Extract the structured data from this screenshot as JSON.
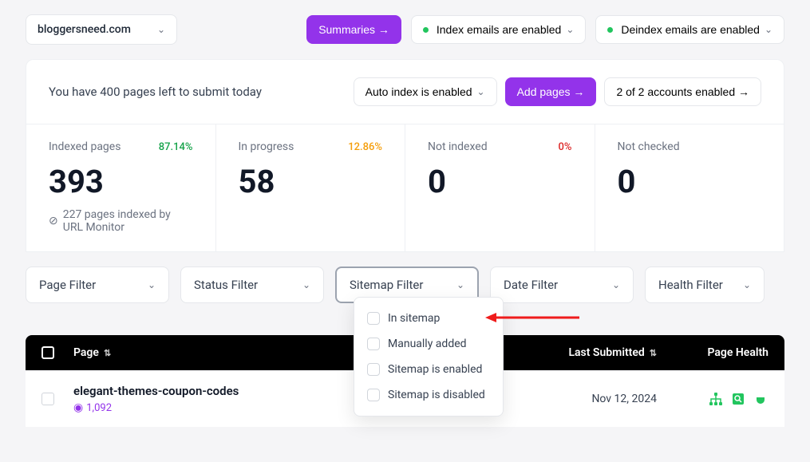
{
  "header": {
    "domain": "bloggersneed.com",
    "summaries": "Summaries →",
    "index_emails": "Index emails are enabled",
    "deindex_emails": "Deindex emails are enabled"
  },
  "submit": {
    "text": "You have 400 pages left to submit today",
    "auto_index": "Auto index is enabled",
    "add_pages": "Add pages →",
    "accounts": "2 of 2 accounts enabled →"
  },
  "stats": {
    "indexed": {
      "label": "Indexed pages",
      "pct": "87.14%",
      "value": "393",
      "sub": "227 pages indexed by URL Monitor"
    },
    "progress": {
      "label": "In progress",
      "pct": "12.86%",
      "value": "58"
    },
    "not_indexed": {
      "label": "Not indexed",
      "pct": "0%",
      "value": "0"
    },
    "not_checked": {
      "label": "Not checked",
      "value": "0"
    }
  },
  "filters": {
    "page": "Page Filter",
    "status": "Status Filter",
    "sitemap": "Sitemap Filter",
    "date": "Date Filter",
    "health": "Health Filter"
  },
  "dropdown": {
    "in_sitemap": "In sitemap",
    "manually": "Manually added",
    "enabled": "Sitemap is enabled",
    "disabled": "Sitemap is disabled"
  },
  "table": {
    "th_page": "Page",
    "th_last": "Last Submitted",
    "th_health": "Page Health",
    "rows": [
      {
        "name": "elegant-themes-coupon-codes",
        "views": "1,092",
        "date": "Nov 12, 2024"
      }
    ]
  }
}
